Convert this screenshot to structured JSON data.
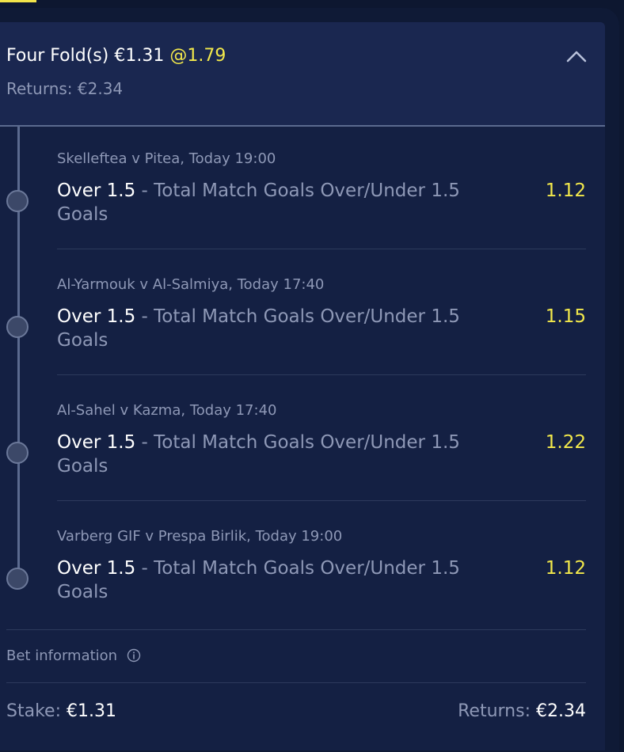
{
  "bet": {
    "title": "Four Fold(s) €1.31",
    "odds": "@1.79",
    "returns_label": "Returns:",
    "returns_value": "€2.34"
  },
  "selections": [
    {
      "match": "Skelleftea v Pitea, Today 19:00",
      "pick": "Over 1.5",
      "market": " - Total Match Goals Over/Under 1.5 Goals",
      "odds": "1.12"
    },
    {
      "match": "Al-Yarmouk v Al-Salmiya, Today 17:40",
      "pick": "Over 1.5",
      "market": " - Total Match Goals Over/Under 1.5 Goals",
      "odds": "1.15"
    },
    {
      "match": "Al-Sahel v Kazma, Today 17:40",
      "pick": "Over 1.5",
      "market": " - Total Match Goals Over/Under 1.5 Goals",
      "odds": "1.22"
    },
    {
      "match": "Varberg GIF v Prespa Birlik, Today 19:00",
      "pick": "Over 1.5",
      "market": " - Total Match Goals Over/Under 1.5 Goals",
      "odds": "1.12"
    }
  ],
  "footer": {
    "bet_information": "Bet information",
    "stake_label": "Stake:",
    "stake_value": "€1.31",
    "returns_label": "Returns:",
    "returns_value": "€2.34"
  },
  "icons": {
    "collapse": "chevron-up-icon",
    "info": "info-icon"
  },
  "colors": {
    "odds_accent": "#f2e84b",
    "background": "#142043",
    "header": "#1a2750"
  }
}
